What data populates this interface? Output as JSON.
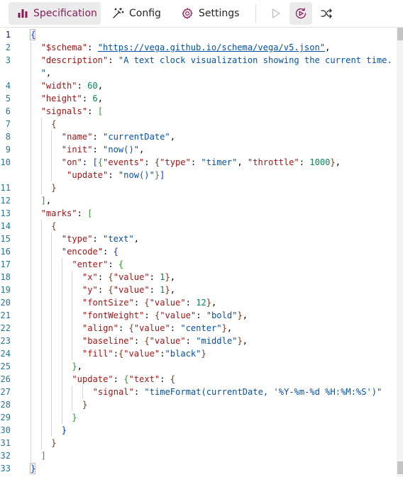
{
  "toolbar": {
    "tabs": [
      {
        "label": "Specification",
        "icon": "bar-chart-icon",
        "active": true
      },
      {
        "label": "Config",
        "icon": "wand-icon",
        "active": false
      },
      {
        "label": "Settings",
        "icon": "gear-icon",
        "active": false
      }
    ],
    "actions": [
      {
        "icon": "play-icon",
        "active": false
      },
      {
        "icon": "auto-run-icon",
        "active": true
      },
      {
        "icon": "shuffle-icon",
        "active": false
      }
    ],
    "accent_color": "#8a1b5b"
  },
  "editor": {
    "active_line": 1,
    "line_numbers": [
      "1",
      "2",
      "3",
      "",
      "4",
      "5",
      "6",
      "7",
      "8",
      "9",
      "10",
      "",
      "11",
      "12",
      "13",
      "14",
      "15",
      "16",
      "17",
      "18",
      "19",
      "20",
      "21",
      "22",
      "23",
      "24",
      "25",
      "26",
      "27",
      "28",
      "29",
      "30",
      "31",
      "32",
      "33"
    ],
    "lines": [
      {
        "indent": 0,
        "tokens": [
          [
            "b1",
            "{"
          ]
        ]
      },
      {
        "indent": 1,
        "tokens": [
          [
            "k",
            "\"$schema\""
          ],
          [
            "p",
            ": "
          ],
          [
            "s url",
            "\"https://vega.github.io/schema/vega/v5.json\""
          ],
          [
            "p",
            ","
          ]
        ]
      },
      {
        "indent": 1,
        "tokens": [
          [
            "k",
            "\"description\""
          ],
          [
            "p",
            ": "
          ],
          [
            "s",
            "\"A text clock visualization showing the current time."
          ]
        ]
      },
      {
        "indent": 1,
        "tokens": [
          [
            "s",
            "\""
          ],
          [
            "p",
            ","
          ]
        ]
      },
      {
        "indent": 1,
        "tokens": [
          [
            "k",
            "\"width\""
          ],
          [
            "p",
            ": "
          ],
          [
            "n",
            "60"
          ],
          [
            "p",
            ","
          ]
        ]
      },
      {
        "indent": 1,
        "tokens": [
          [
            "k",
            "\"height\""
          ],
          [
            "p",
            ": "
          ],
          [
            "n",
            "6"
          ],
          [
            "p",
            ","
          ]
        ]
      },
      {
        "indent": 1,
        "tokens": [
          [
            "k",
            "\"signals\""
          ],
          [
            "p",
            ": "
          ],
          [
            "b2",
            "["
          ]
        ]
      },
      {
        "indent": 2,
        "tokens": [
          [
            "b3",
            "{"
          ]
        ]
      },
      {
        "indent": 3,
        "tokens": [
          [
            "k",
            "\"name\""
          ],
          [
            "p",
            ": "
          ],
          [
            "s",
            "\"currentDate\""
          ],
          [
            "p",
            ","
          ]
        ]
      },
      {
        "indent": 3,
        "tokens": [
          [
            "k",
            "\"init\""
          ],
          [
            "p",
            ": "
          ],
          [
            "s",
            "\"now()\""
          ],
          [
            "p",
            ","
          ]
        ]
      },
      {
        "indent": 3,
        "tokens": [
          [
            "k",
            "\"on\""
          ],
          [
            "p",
            ": "
          ],
          [
            "b1",
            "["
          ],
          [
            "b2",
            "{"
          ],
          [
            "k",
            "\"events\""
          ],
          [
            "p",
            ": "
          ],
          [
            "b3",
            "{"
          ],
          [
            "k",
            "\"type\""
          ],
          [
            "p",
            ": "
          ],
          [
            "s",
            "\"timer\""
          ],
          [
            "p",
            ", "
          ],
          [
            "k",
            "\"throttle\""
          ],
          [
            "p",
            ": "
          ],
          [
            "n",
            "1000"
          ],
          [
            "b3",
            "}"
          ],
          [
            "p",
            ","
          ]
        ]
      },
      {
        "indent": 3,
        "tokens": [
          [
            "p",
            " "
          ],
          [
            "k",
            "\"update\""
          ],
          [
            "p",
            ": "
          ],
          [
            "s",
            "\"now()\""
          ],
          [
            "b2",
            "}"
          ],
          [
            "b1",
            "]"
          ]
        ]
      },
      {
        "indent": 2,
        "tokens": [
          [
            "b3",
            "}"
          ]
        ]
      },
      {
        "indent": 1,
        "tokens": [
          [
            "b2",
            "]"
          ],
          [
            "p",
            ","
          ]
        ]
      },
      {
        "indent": 1,
        "tokens": [
          [
            "k",
            "\"marks\""
          ],
          [
            "p",
            ": "
          ],
          [
            "b2",
            "["
          ]
        ]
      },
      {
        "indent": 2,
        "tokens": [
          [
            "b3",
            "{"
          ]
        ]
      },
      {
        "indent": 3,
        "tokens": [
          [
            "k",
            "\"type\""
          ],
          [
            "p",
            ": "
          ],
          [
            "s",
            "\"text\""
          ],
          [
            "p",
            ","
          ]
        ]
      },
      {
        "indent": 3,
        "tokens": [
          [
            "k",
            "\"encode\""
          ],
          [
            "p",
            ": "
          ],
          [
            "b1",
            "{"
          ]
        ]
      },
      {
        "indent": 4,
        "tokens": [
          [
            "k",
            "\"enter\""
          ],
          [
            "p",
            ": "
          ],
          [
            "b2",
            "{"
          ]
        ]
      },
      {
        "indent": 5,
        "tokens": [
          [
            "k",
            "\"x\""
          ],
          [
            "p",
            ": "
          ],
          [
            "b3",
            "{"
          ],
          [
            "k",
            "\"value\""
          ],
          [
            "p",
            ": "
          ],
          [
            "n",
            "1"
          ],
          [
            "b3",
            "}"
          ],
          [
            "p",
            ","
          ]
        ]
      },
      {
        "indent": 5,
        "tokens": [
          [
            "k",
            "\"y\""
          ],
          [
            "p",
            ": "
          ],
          [
            "b3",
            "{"
          ],
          [
            "k",
            "\"value\""
          ],
          [
            "p",
            ": "
          ],
          [
            "n",
            "1"
          ],
          [
            "b3",
            "}"
          ],
          [
            "p",
            ","
          ]
        ]
      },
      {
        "indent": 5,
        "tokens": [
          [
            "k",
            "\"fontSize\""
          ],
          [
            "p",
            ": "
          ],
          [
            "b3",
            "{"
          ],
          [
            "k",
            "\"value\""
          ],
          [
            "p",
            ": "
          ],
          [
            "n",
            "12"
          ],
          [
            "b3",
            "}"
          ],
          [
            "p",
            ","
          ]
        ]
      },
      {
        "indent": 5,
        "tokens": [
          [
            "k",
            "\"fontWeight\""
          ],
          [
            "p",
            ": "
          ],
          [
            "b3",
            "{"
          ],
          [
            "k",
            "\"value\""
          ],
          [
            "p",
            ": "
          ],
          [
            "s",
            "\"bold\""
          ],
          [
            "b3",
            "}"
          ],
          [
            "p",
            ","
          ]
        ]
      },
      {
        "indent": 5,
        "tokens": [
          [
            "k",
            "\"align\""
          ],
          [
            "p",
            ": "
          ],
          [
            "b3",
            "{"
          ],
          [
            "k",
            "\"value\""
          ],
          [
            "p",
            ": "
          ],
          [
            "s",
            "\"center\""
          ],
          [
            "b3",
            "}"
          ],
          [
            "p",
            ","
          ]
        ]
      },
      {
        "indent": 5,
        "tokens": [
          [
            "k",
            "\"baseline\""
          ],
          [
            "p",
            ": "
          ],
          [
            "b3",
            "{"
          ],
          [
            "k",
            "\"value\""
          ],
          [
            "p",
            ": "
          ],
          [
            "s",
            "\"middle\""
          ],
          [
            "b3",
            "}"
          ],
          [
            "p",
            ","
          ]
        ]
      },
      {
        "indent": 5,
        "tokens": [
          [
            "k",
            "\"fill\""
          ],
          [
            "p",
            ":"
          ],
          [
            "b3",
            "{"
          ],
          [
            "k",
            "\"value\""
          ],
          [
            "p",
            ":"
          ],
          [
            "s",
            "\"black\""
          ],
          [
            "b3",
            "}"
          ]
        ]
      },
      {
        "indent": 4,
        "tokens": [
          [
            "b2",
            "}"
          ],
          [
            "p",
            ","
          ]
        ]
      },
      {
        "indent": 4,
        "tokens": [
          [
            "k",
            "\"update\""
          ],
          [
            "p",
            ": "
          ],
          [
            "b2",
            "{"
          ],
          [
            "k",
            "\"text\""
          ],
          [
            "p",
            ": "
          ],
          [
            "b3",
            "{"
          ]
        ]
      },
      {
        "indent": 6,
        "tokens": [
          [
            "k",
            "\"signal\""
          ],
          [
            "p",
            ": "
          ],
          [
            "s",
            "\"timeFormat(currentDate, '%Y-%m-%d %H:%M:%S')\""
          ]
        ]
      },
      {
        "indent": 5,
        "tokens": [
          [
            "b3",
            "}"
          ]
        ]
      },
      {
        "indent": 4,
        "tokens": [
          [
            "b2",
            "}"
          ]
        ]
      },
      {
        "indent": 3,
        "tokens": [
          [
            "b1",
            "}"
          ]
        ]
      },
      {
        "indent": 2,
        "tokens": [
          [
            "b3",
            "}"
          ]
        ]
      },
      {
        "indent": 1,
        "tokens": [
          [
            "b2",
            "]"
          ]
        ]
      },
      {
        "indent": 0,
        "tokens": [
          [
            "b1",
            "}"
          ]
        ]
      }
    ]
  }
}
